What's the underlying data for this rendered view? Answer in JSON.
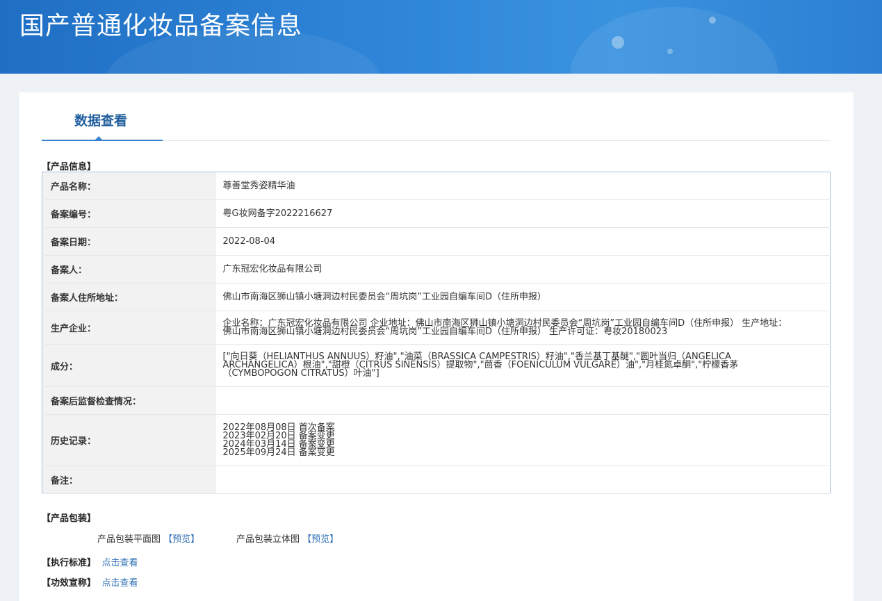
{
  "page_title": "国产普通化妆品备案信息",
  "tab": {
    "label": "数据查看"
  },
  "sections": {
    "product_info": "【产品信息】",
    "packaging": "【产品包装】",
    "standard": "【执行标准】",
    "efficacy": "【功效宣称】"
  },
  "rows": [
    {
      "label": "产品名称：",
      "value": "尊善堂秀姿精华油"
    },
    {
      "label": "备案编号：",
      "value": "粤G妆网备字2022216627"
    },
    {
      "label": "备案日期：",
      "value": "2022-08-04"
    },
    {
      "label": "备案人：",
      "value": "广东冠宏化妆品有限公司"
    },
    {
      "label": "备案人住所地址：",
      "value": "佛山市南海区狮山镇小塘洞边村民委员会“周坑岗”工业园自编车间D（住所申报）"
    },
    {
      "label": "生产企业：",
      "value": "企业名称：广东冠宏化妆品有限公司 企业地址：佛山市南海区狮山镇小塘洞边村民委员会“周坑岗”工业园自编车间D（住所申报） 生产地址：佛山市南海区狮山镇小塘洞边村民委员会“周坑岗”工业园自编车间D（住所申报） 生产许可证：粤妆20180023"
    },
    {
      "label": "成分：",
      "value": "[\"向日葵（HELIANTHUS ANNUUS）籽油\",\"油菜（BRASSICA CAMPESTRIS）籽油\",\"香兰基丁基醚\",\"圆叶当归（ANGELICA ARCHANGELICA）根油\",\"甜橙（CITRUS SINENSIS）提取物\",\"茴香（FOENICULUM VULGARE）油\",\"月桂氮卓酮\",\"柠檬香茅（CYMBOPOGON CITRATUS）叶油\"]"
    },
    {
      "label": "备案后监督检查情况：",
      "value": ""
    },
    {
      "label": "历史记录：",
      "value": ""
    },
    {
      "label": "备注：",
      "value": ""
    }
  ],
  "history": [
    "2022年08月08日 首次备案",
    "2023年02月20日 备案变更",
    "2024年03月14日 备案变更",
    "2025年09月24日 备案变更"
  ],
  "packaging": {
    "flat_label": "产品包装平面图",
    "flat_preview": "【预览】",
    "solid_label": "产品包装立体图",
    "solid_preview": "【预览】"
  },
  "links": {
    "standard_view": "点击查看",
    "efficacy_view": "点击查看"
  }
}
